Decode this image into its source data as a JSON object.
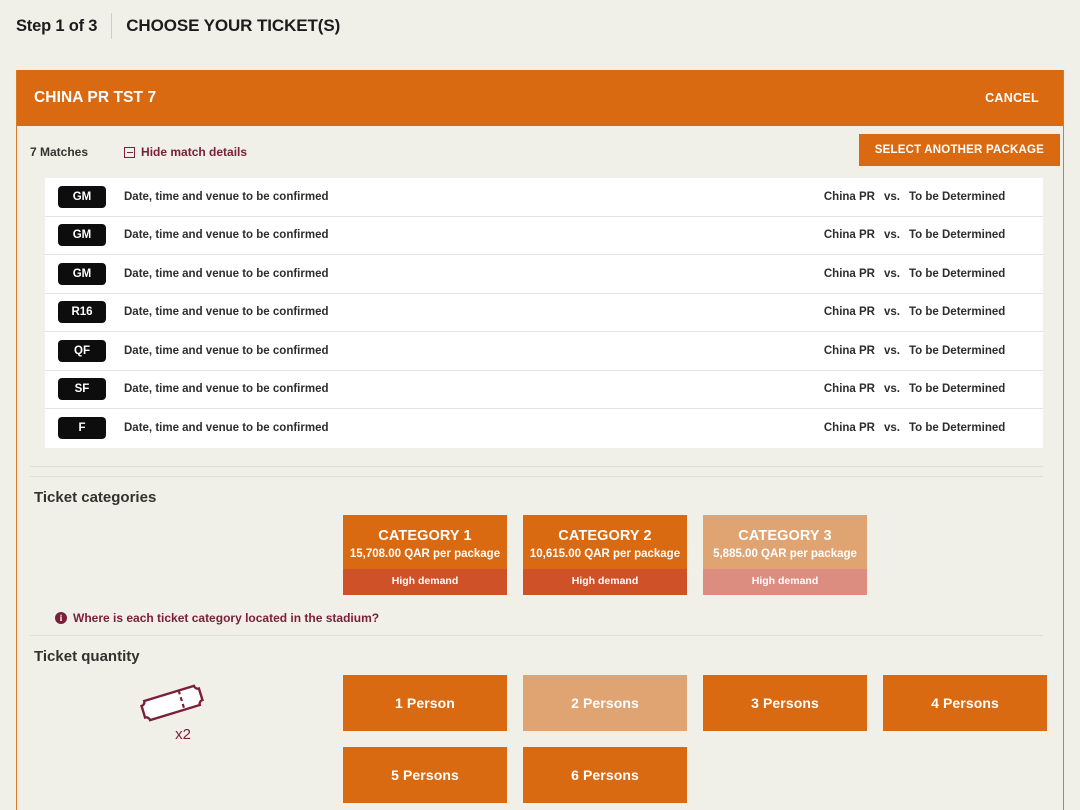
{
  "step": {
    "label": "Step 1 of 3",
    "title": "CHOOSE YOUR TICKET(S)"
  },
  "panel": {
    "title": "CHINA PR TST 7",
    "cancel_label": "CANCEL"
  },
  "matches_bar": {
    "count_label": "7 Matches",
    "toggle_label": "Hide match details",
    "toggle_icon": "minus-box-icon",
    "select_package_label": "SELECT ANOTHER PACKAGE"
  },
  "matches": [
    {
      "badge": "GM",
      "info": "Date, time and venue to be confirmed",
      "home": "China PR",
      "vs": "vs.",
      "away": "To be Determined"
    },
    {
      "badge": "GM",
      "info": "Date, time and venue to be confirmed",
      "home": "China PR",
      "vs": "vs.",
      "away": "To be Determined"
    },
    {
      "badge": "GM",
      "info": "Date, time and venue to be confirmed",
      "home": "China PR",
      "vs": "vs.",
      "away": "To be Determined"
    },
    {
      "badge": "R16",
      "info": "Date, time and venue to be confirmed",
      "home": "China PR",
      "vs": "vs.",
      "away": "To be Determined"
    },
    {
      "badge": "QF",
      "info": "Date, time and venue to be confirmed",
      "home": "China PR",
      "vs": "vs.",
      "away": "To be Determined"
    },
    {
      "badge": "SF",
      "info": "Date, time and venue to be confirmed",
      "home": "China PR",
      "vs": "vs.",
      "away": "To be Determined"
    },
    {
      "badge": "F",
      "info": "Date, time and venue to be confirmed",
      "home": "China PR",
      "vs": "vs.",
      "away": "To be Determined"
    }
  ],
  "ticket_categories": {
    "heading": "Ticket categories",
    "items": [
      {
        "name": "CATEGORY 1",
        "price": "15,708.00 QAR per package",
        "demand": "High demand",
        "state": "normal"
      },
      {
        "name": "CATEGORY 2",
        "price": "10,615.00 QAR per package",
        "demand": "High demand",
        "state": "normal"
      },
      {
        "name": "CATEGORY 3",
        "price": "5,885.00 QAR per package",
        "demand": "High demand",
        "state": "faded"
      }
    ],
    "stadium_link": "Where is each ticket category located in the stadium?",
    "stadium_link_icon": "info-circle-icon"
  },
  "ticket_quantity": {
    "heading": "Ticket quantity",
    "ticket_icon": "ticket-icon",
    "multiplier": "x2",
    "options": [
      {
        "label": "1 Person",
        "state": "normal"
      },
      {
        "label": "2 Persons",
        "state": "faded"
      },
      {
        "label": "3 Persons",
        "state": "normal"
      },
      {
        "label": "4 Persons",
        "state": "normal"
      },
      {
        "label": "5 Persons",
        "state": "normal"
      },
      {
        "label": "6 Persons",
        "state": "normal"
      }
    ]
  },
  "colors": {
    "brand_orange": "#d96a12",
    "demand_band": "#cf5128",
    "maroon": "#7a2038",
    "page_bg": "#f0efe8",
    "badge_black": "#0d0d0d"
  }
}
